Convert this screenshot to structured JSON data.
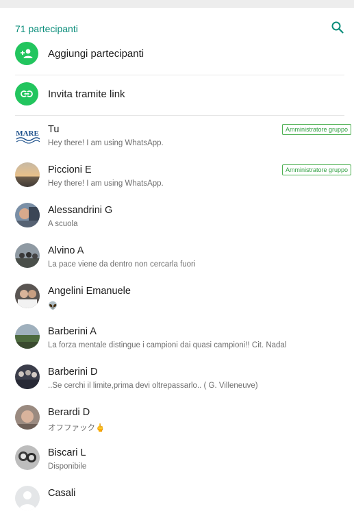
{
  "header": {
    "participants_count": "71 partecipanti"
  },
  "actions": [
    {
      "label": "Aggiungi partecipanti",
      "icon": "add-person-icon"
    },
    {
      "label": "Invita tramite link",
      "icon": "link-icon"
    }
  ],
  "colors": {
    "accent_green": "#22c55e",
    "header_teal": "#0a8d7a",
    "badge_green": "#4caf50"
  },
  "participants": [
    {
      "name": "Tu",
      "status": "Hey there! I am using WhatsApp.",
      "badge": "Amministratore gruppo",
      "avatar_icon": "mare-logo-avatar",
      "avatar_text": "MARE"
    },
    {
      "name": "Piccioni E",
      "status": "Hey there! I am using WhatsApp.",
      "badge": "Amministratore gruppo",
      "avatar_icon": "sunset-photo-avatar"
    },
    {
      "name": "Alessandrini G",
      "status": "A scuola",
      "badge": "",
      "avatar_icon": "person-photo-avatar"
    },
    {
      "name": "Alvino A",
      "status": "La pace viene da dentro non cercarla fuori",
      "badge": "",
      "avatar_icon": "group-photo-avatar"
    },
    {
      "name": "Angelini Emanuele",
      "status": "👽",
      "badge": "",
      "avatar_icon": "people-photo-avatar"
    },
    {
      "name": "Barberini A",
      "status": "La forza mentale distingue i campioni dai quasi campioni!! Cit. Nadal",
      "badge": "",
      "avatar_icon": "landscape-photo-avatar"
    },
    {
      "name": "Barberini D",
      "status": "..Se cerchi il limite,prima devi oltrepassarlo.. ( G. Villeneuve)",
      "badge": "",
      "avatar_icon": "crowd-photo-avatar"
    },
    {
      "name": "Berardi D",
      "status": "オフファック🖕",
      "badge": "",
      "avatar_icon": "portrait-photo-avatar"
    },
    {
      "name": "Biscari L",
      "status": "Disponibile",
      "badge": "",
      "avatar_icon": "bw-photo-avatar"
    },
    {
      "name": "Casali",
      "status": "",
      "badge": "",
      "avatar_icon": "default-person-avatar"
    }
  ]
}
